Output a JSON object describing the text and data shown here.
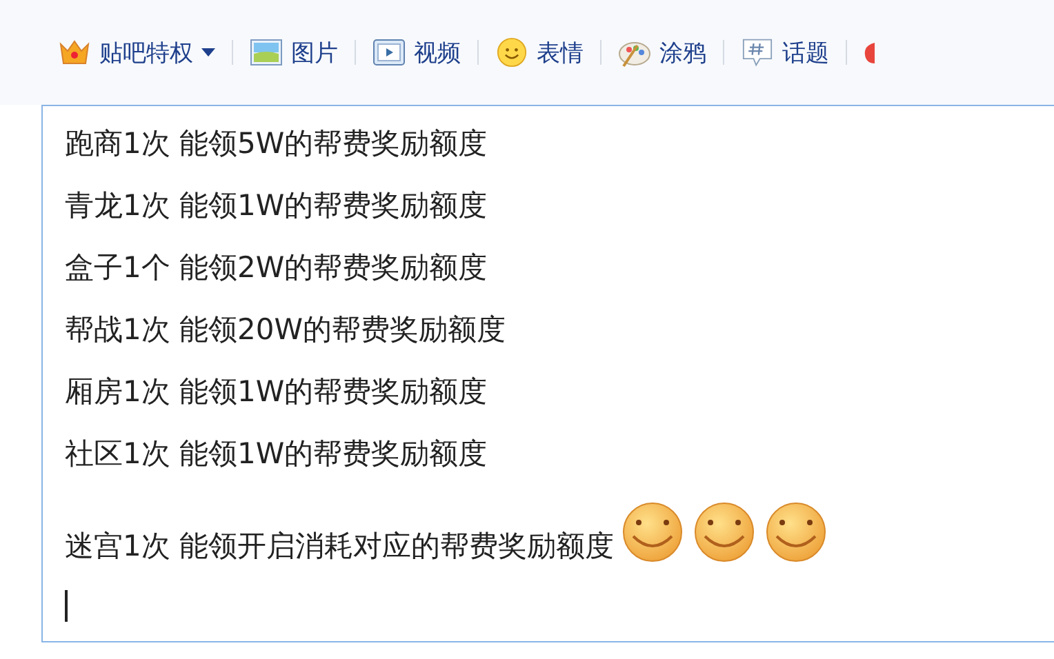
{
  "toolbar": [
    {
      "kind": "crown",
      "label": "贴吧特权",
      "dropdown": true
    },
    {
      "kind": "image",
      "label": "图片",
      "dropdown": false
    },
    {
      "kind": "video",
      "label": "视频",
      "dropdown": false
    },
    {
      "kind": "smiley",
      "label": "表情",
      "dropdown": false
    },
    {
      "kind": "palette",
      "label": "涂鸦",
      "dropdown": false
    },
    {
      "kind": "topic",
      "label": "话题",
      "dropdown": false
    },
    {
      "kind": "partial",
      "dropdown": false
    }
  ],
  "editor": {
    "lines": [
      {
        "text": "跑商1次 能领5W的帮费奖励额度"
      },
      {
        "text": "青龙1次 能领1W的帮费奖励额度"
      },
      {
        "text": "盒子1个 能领2W的帮费奖励额度"
      },
      {
        "text": "帮战1次 能领20W的帮费奖励额度"
      },
      {
        "text": "厢房1次 能领1W的帮费奖励额度"
      },
      {
        "text": "社区1次 能领1W的帮费奖励额度"
      },
      {
        "text": "迷宫1次 能领开启消耗对应的帮费奖励额度",
        "emoticons": [
          {
            "kind": "grin"
          },
          {
            "kind": "grin"
          },
          {
            "kind": "grin"
          }
        ]
      }
    ],
    "caret": true
  }
}
